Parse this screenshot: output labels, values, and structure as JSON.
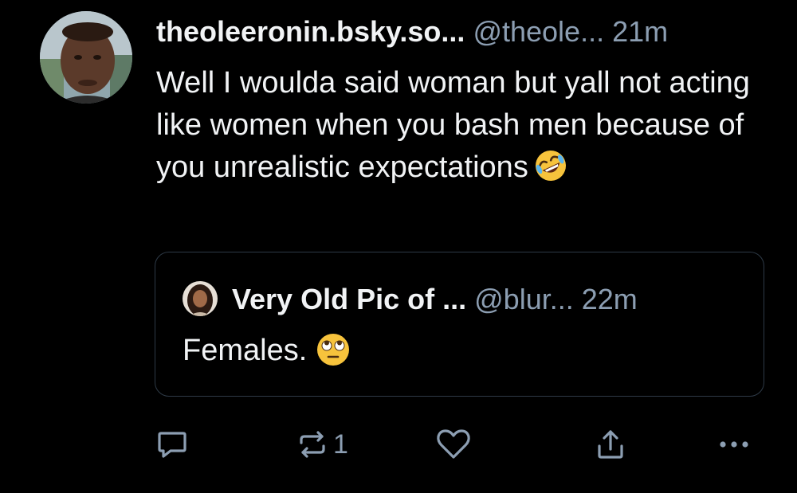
{
  "post": {
    "author": {
      "display_name": "theoleeronin.bsky.so...",
      "handle": "@theole...",
      "time": "21m"
    },
    "text": "Well I woulda said woman but yall not acting like women when you bash men because of you unrealistic expectations",
    "text_emoji": "rolling-on-floor-laughing-emoji",
    "quote": {
      "display_name": "Very Old Pic of ...",
      "handle": "@blur...",
      "time": "22m",
      "text": "Females.",
      "text_emoji": "face-with-rolling-eyes-emoji"
    },
    "actions": {
      "reply_icon": "reply-icon",
      "repost_icon": "repost-icon",
      "repost_count": "1",
      "like_icon": "heart-icon",
      "share_icon": "share-icon",
      "more_icon": "more-icon"
    }
  },
  "colors": {
    "background": "#000000",
    "text": "#f1f3f5",
    "muted": "#8c9eb2",
    "border": "#2e3a47"
  }
}
